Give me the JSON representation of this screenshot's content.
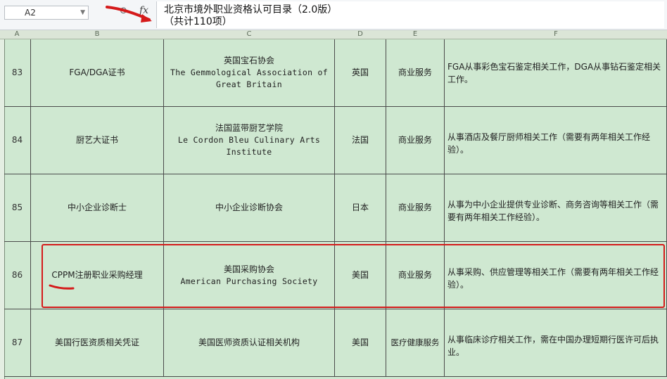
{
  "formula_bar": {
    "cell_ref": "A2",
    "fx_label": "fx",
    "formula_line1": "北京市境外职业资格认可目录（2.0版）",
    "formula_line2": "（共计110项）"
  },
  "column_headers": [
    "A",
    "B",
    "C",
    "D",
    "E",
    "F"
  ],
  "rows": [
    {
      "num": "83",
      "cert": "FGA/DGA证书",
      "org_cn": "英国宝石协会",
      "org_en": [
        "The Gemmological Association of",
        "Great Britain"
      ],
      "country": "英国",
      "category": "商业服务",
      "description": "FGA从事彩色宝石鉴定相关工作，DGA从事钻石鉴定相关工作。"
    },
    {
      "num": "84",
      "cert": "厨艺大证书",
      "org_cn": "法国蓝带厨艺学院",
      "org_en": [
        "Le Cordon Bleu Culinary Arts",
        "Institute"
      ],
      "country": "法国",
      "category": "商业服务",
      "description": "从事酒店及餐厅厨师相关工作（需要有两年相关工作经验）。"
    },
    {
      "num": "85",
      "cert": "中小企业诊断士",
      "org_cn": "中小企业诊断协会",
      "org_en": [],
      "country": "日本",
      "category": "商业服务",
      "description": "从事为中小企业提供专业诊断、商务咨询等相关工作（需要有两年相关工作经验）。"
    },
    {
      "num": "86",
      "cert": "CPPM注册职业采购经理",
      "org_cn": "美国采购协会",
      "org_en": [
        "American Purchasing Society"
      ],
      "country": "美国",
      "category": "商业服务",
      "description": "从事采购、供应管理等相关工作（需要有两年相关工作经验）。"
    },
    {
      "num": "87",
      "cert": "美国行医资质相关凭证",
      "org_cn": "美国医师资质认证相关机构",
      "org_en": [],
      "country": "美国",
      "category": "医疗健康服务",
      "description": "从事临床诊疗相关工作，需在中国办理短期行医许可后执业。"
    }
  ],
  "colors": {
    "cell_fill": "#cfe8d1",
    "grid_line": "#4b4b4b",
    "annotation_red": "#d51a1a"
  }
}
